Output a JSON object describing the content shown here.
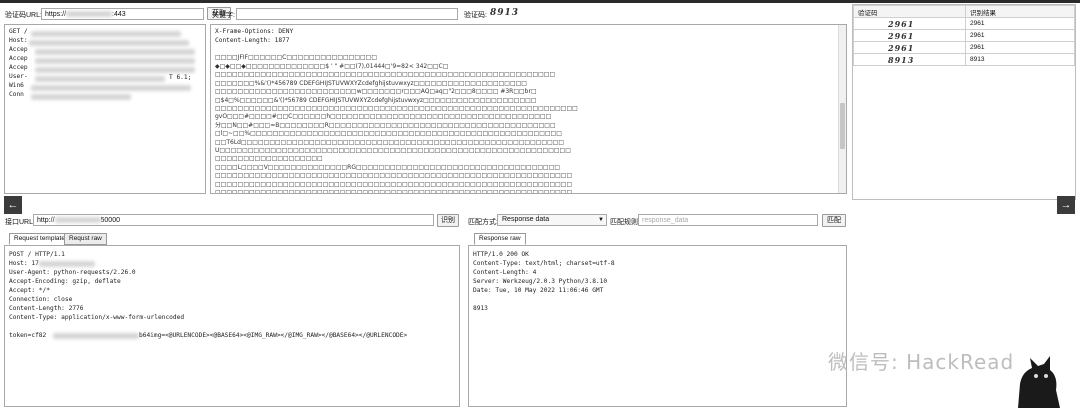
{
  "top": {
    "url_label": "验证码URL:",
    "url_value": "https://",
    "url_suffix": ":443",
    "fetch_button": "获取",
    "keyword_label": "关键字:",
    "captcha_label": "验证码:",
    "captcha_value": "8913"
  },
  "request_panel": {
    "lines": [
      "GET /",
      "Host:",
      "Accep",
      "Accep",
      "Accep",
      "User-",
      "Win6",
      "Conn"
    ],
    "useragent_tail": "T 6.1;"
  },
  "response_panel": {
    "lines": [
      "X-Frame-Options: DENY",
      "Content-Length: 1877"
    ],
    "jfif": "□□□□JFIF□□□□□□C□□□□□□□□□□□□□□□□",
    "garble": [
      "◆□◆□□◆□□□□□□□□□□□□□□$ ' \" #□□(7),01444□'9=82< 342□□C□",
      "□□□□□□□□□□□□□□□□□□□□□□□□□□□□□□□□□□□□□□□□□□□□□□□□□□□□□□□□□□□□",
      "□□□□□□□%&'()*456789 CDEFGHIJSTUVWXYZcdefghijstuvwxyz□□□□□□□□□□□□□□□□□□□□",
      "□□□□□□□□□□□□□□□□□□□□□□□□□w□□□□□□□r□□□AQ□aq□\"2□□□8□□□□   #3R□□br□",
      "□$4□%□□□□□□&'()*56789 CDEFGHIJSTUVWXYZcdefghijstuvwxyz□□□□□□□□□□□□□□□□□□□□",
      "□□□□□□□□□□□□□□□□□□□□□□□□□□□□□□□□□□□□□□□□□□□□□□□□□□□□□□□□□□□□□□□□",
      "gvO□□□#□□□□#□□C□□□□□□h□□□□□□□□□□□□□□□□□□□□□□□□□□□□□□□□□□□□□□□",
      "分□□N□□#□□□=B□□□□□□□□R□□□□□□□□□□□□□□□□□□□□□□□□□□□□□□□□□□□□□□□□",
      "□l□~□□%□□□□□□□□□□□□□□□□□□□□□□□□□□□□□□□□□□□□□□□□□□□□□□□□□□□□□□□",
      "□□T6Ld□□□□□□□□□□□□□□□□□□□□□□□□□□□□□□□□□□□□□□□□□□□□□□□□□□□□□□□□□",
      "U□□□□□□□□□□□□□□□□□□□□□□□□□□□□□□□□□□□□□□□□□□□□□□□□□□□□□□□□□□□□□□",
      "□□□□□□□□□□□□□□□□□□□",
      "□□□□L□□□□V□□□□□□□□□□□□□□RG□□□□□□□□□□□□□□□□□□□□□□□□□□□□□□□□□□□□",
      "□□□□□□□□□□□□□□□□□□□□□□□□□□□□□□□□□□□□□□□□□□□□□□□□□□□□□□□□□□□□□□□",
      "□□□□□□□□□□□□□□□□□□□□□□□□□□□□□□□□□□□□□□□□□□□□□□□□□□□□□□□□□□□□□□□",
      "□□□□□□□□□□□□□□□□□□□□□□□□□□□□□□□□□□□□□□□□□□□□□□□□□□□□□□□□□□□□□□□",
      "□□□□□□□□□□□□□□□□□□□□□□□□□□□□□□□□□□□□□□□□□□□□□□□□□□□□□□□□□□□□□□□",
      "□□□□□□□□□□□□□□□□□□□□□□□□□□□□□□□□□□□□□□□□□□□□□□□□□□□□□□□□□□□□□□□",
      "□□□□□□□□□□□□□□□□□□□□□□□□□□□□□□□□□□□□□□□□□□□□□□□□□□□□□□□□□□□□□□□",
      "□□□□□□□□□□□□□□□□□□□□□□□□□□□□□□□□□□□□□□□□□□□□□□□□□□□□□□□□□□□□□□□",
      "□□□□□□□□□□□□□□□□□□□□□□□□□□□□□□□□□□□□□□□□□□□□□□□□□□□□□□□□□□□□□□□",
      "□□□□□□□□□□□□□□□□□□□□□□□□□□□□□□□□□□□□□□□□□□□□□□□□□□□□□□□□□□□□□□□"
    ]
  },
  "results": {
    "header_code": "验证码",
    "header_result": "识别结果",
    "rows": [
      {
        "img": "2961",
        "result": "2961"
      },
      {
        "img": "2961",
        "result": "2961"
      },
      {
        "img": "2961",
        "result": "2961"
      },
      {
        "img": "8913",
        "result": "8913"
      }
    ]
  },
  "middle": {
    "api_label": "接口URL:",
    "api_value_prefix": "http://",
    "api_value_suffix": "50000",
    "identify_button": "识别",
    "match_label": "匹配方式:",
    "match_value": "Response data",
    "match_rule_label": "匹配规则:",
    "match_rule_placeholder": "response_data",
    "match_button": "匹配"
  },
  "left_tabs": [
    "Request template",
    "Requst raw"
  ],
  "right_tabs": [
    "Response raw"
  ],
  "request_template": {
    "lines": [
      "POST / HTTP/1.1",
      "Host: 17",
      "User-Agent: python-requests/2.26.0",
      "Accept-Encoding: gzip, deflate",
      "Accept: */*",
      "Connection: close",
      "Content-Length: 2776",
      "Content-Type: application/x-www-form-urlencoded",
      "",
      "token=cf82"
    ],
    "body_tail": "b64img=<@URLENCODE><@BASE64><@IMG_RAW></@IMG_RAW></@BASE64></@URLENCODE>"
  },
  "response_raw": {
    "lines": [
      "HTTP/1.0 200 OK",
      "Content-Type: text/html; charset=utf-8",
      "Content-Length: 4",
      "Server: Werkzeug/2.0.3 Python/3.8.10",
      "Date: Tue, 10 May 2022 11:06:46 GMT",
      "",
      "8913"
    ]
  },
  "watermark": "微信号: HackRead",
  "nav": {
    "left_arrow": "←",
    "right_arrow": "→"
  }
}
